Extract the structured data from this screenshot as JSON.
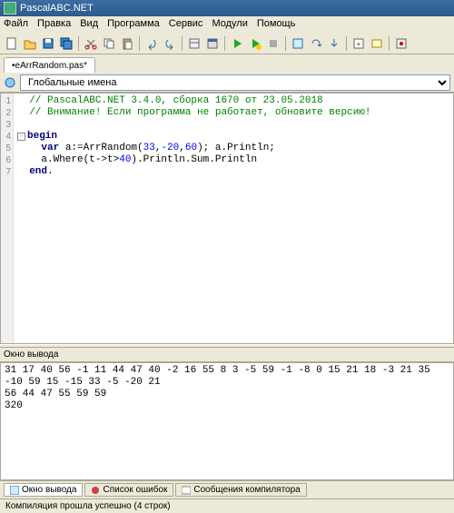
{
  "window": {
    "title": "PascalABC.NET"
  },
  "menu": {
    "items": [
      "Файл",
      "Правка",
      "Вид",
      "Программа",
      "Сервис",
      "Модули",
      "Помощь"
    ]
  },
  "tab": {
    "label": "•eArrRandom.pas*"
  },
  "scope": {
    "label": "Глобальные имена"
  },
  "code": {
    "lines": [
      {
        "n": 1,
        "html": "  <span class=\"c-comment\">// PascalABC.NET 3.4.0, сборка 1670 от 23.05.2018</span>"
      },
      {
        "n": 2,
        "html": "  <span class=\"c-comment\">// Внимание! Если программа не работает, обновите версию!</span>"
      },
      {
        "n": 3,
        "html": ""
      },
      {
        "n": 4,
        "html": "<span class=\"fold\">-</span><span class=\"c-keyword\">begin</span>"
      },
      {
        "n": 5,
        "html": "    <span class=\"c-keyword\">var</span> a:=ArrRandom(<span class=\"c-num\">33</span>,<span class=\"c-num\">-20</span>,<span class=\"c-num\">60</span>); a.Println;"
      },
      {
        "n": 6,
        "html": "    a.Where(t->t><span class=\"c-num\">40</span>).Println.Sum.Println"
      },
      {
        "n": 7,
        "html": "  <span class=\"c-keyword\">end</span>."
      }
    ]
  },
  "output": {
    "title": "Окно вывода",
    "lines": [
      "31 17 40 56 -1 11 44 47 40 -2 16 55 8 3 -5 59 -1 -8 0 15 21 18 -3 21 35 -10 59 15 -15 33 -5 -20 21",
      "56 44 47 55 59 59",
      "320"
    ]
  },
  "bottomTabs": {
    "items": [
      {
        "label": "Окно вывода",
        "active": true
      },
      {
        "label": "Список ошибок",
        "active": false
      },
      {
        "label": "Сообщения компилятора",
        "active": false
      }
    ]
  },
  "status": {
    "text": "Компиляция прошла успешно (4 строк)"
  }
}
